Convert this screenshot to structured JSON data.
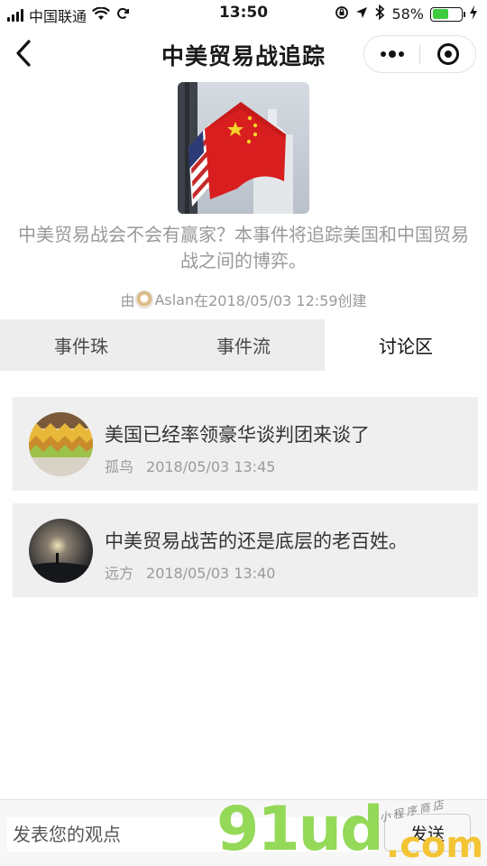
{
  "status_bar": {
    "carrier": "中国联通",
    "time": "13:50",
    "battery_percent": "58%",
    "battery_level": 0.58
  },
  "nav": {
    "title": "中美贸易战追踪"
  },
  "event": {
    "description": "中美贸易战会不会有赢家？本事件将追踪美国和中国贸易战之间的博弈。",
    "creator_prefix": "由",
    "creator_name": "Aslan",
    "creator_suffix": "在2018/05/03 12:59创建"
  },
  "tabs": [
    {
      "label": "事件珠",
      "active": false
    },
    {
      "label": "事件流",
      "active": false
    },
    {
      "label": "讨论区",
      "active": true
    }
  ],
  "comments": [
    {
      "text": "美国已经率领豪华谈判团来谈了",
      "author": "孤鸟",
      "time": "2018/05/03 13:45"
    },
    {
      "text": "中美贸易战苦的还是底层的老百姓。",
      "author": "远方",
      "time": "2018/05/03 13:40"
    }
  ],
  "input": {
    "placeholder": "发表您的观点"
  },
  "send_label": "发送",
  "watermark": {
    "main": "91ud",
    "domain": ".com",
    "small_text": "小程序商店"
  }
}
